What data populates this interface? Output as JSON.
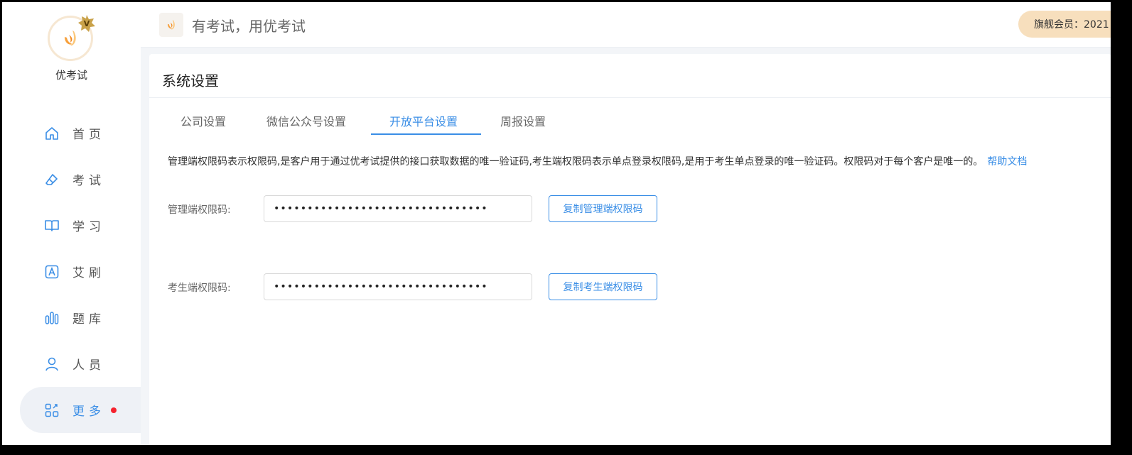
{
  "brand": {
    "name": "优考试",
    "vip_mark": "V"
  },
  "nav": {
    "items": [
      {
        "label": "首页",
        "icon": "home-icon"
      },
      {
        "label": "考试",
        "icon": "eraser-icon"
      },
      {
        "label": "学习",
        "icon": "book-icon"
      },
      {
        "label": "艾刷",
        "icon": "letter-a-icon"
      },
      {
        "label": "题库",
        "icon": "bars-icon"
      },
      {
        "label": "人员",
        "icon": "user-icon"
      },
      {
        "label": "更多",
        "icon": "grid-icon"
      }
    ]
  },
  "header": {
    "slogan": "有考试，用优考试",
    "member": "旗舰会员：2021"
  },
  "page": {
    "title": "系统设置",
    "tabs": [
      "公司设置",
      "微信公众号设置",
      "开放平台设置",
      "周报设置"
    ],
    "active_tab": "开放平台设置",
    "description": "管理端权限码表示权限码,是客户用于通过优考试提供的接口获取数据的唯一验证码,考生端权限码表示单点登录权限码,是用于考生单点登录的唯一验证码。权限码对于每个客户是唯一的。",
    "help_link": "帮助文档"
  },
  "admin_code": {
    "label": "管理端权限码:",
    "masked_value": "••••••••••••••••••••••••••••••••",
    "copy_button": "复制管理端权限码"
  },
  "examinee_code": {
    "label": "考生端权限码:",
    "masked_value": "••••••••••••••••••••••••••••••••",
    "copy_button": "复制考生端权限码"
  },
  "colors": {
    "accent": "#3a8ee6",
    "member_badge": "#f7dfbd",
    "notification_dot": "#f5222d",
    "logo_orange": "#f7a03c"
  }
}
